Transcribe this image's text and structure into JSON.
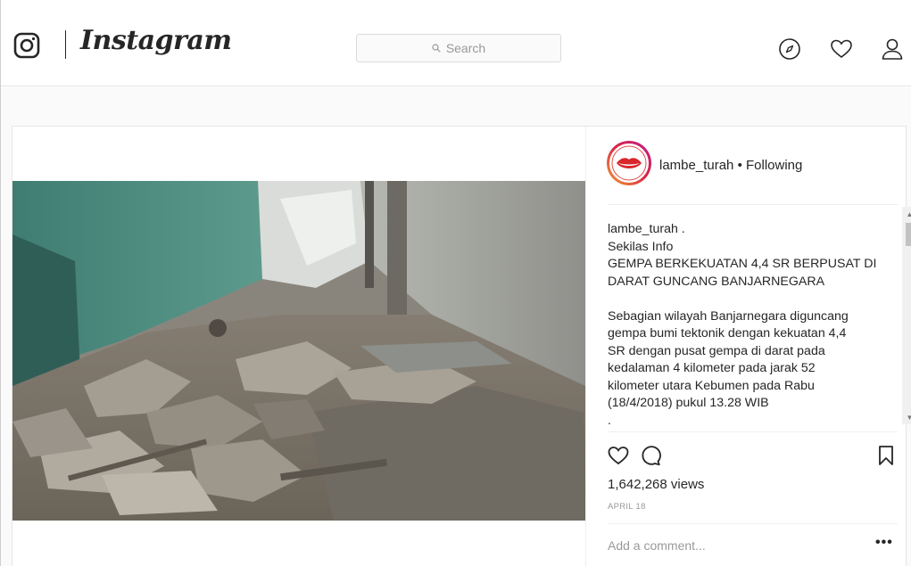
{
  "nav": {
    "brand": "Instagram",
    "search_placeholder": "Search",
    "icons": [
      "instagram-logo-icon",
      "compass-icon",
      "heart-icon",
      "person-icon"
    ]
  },
  "post": {
    "username": "lambe_turah",
    "separator": "•",
    "follow_status": "Following",
    "caption_lines": [
      "lambe_turah .",
      "Sekilas Info",
      "GEMPA BERKEKUATAN 4,4 SR BERPUSAT DI",
      "DARAT GUNCANG BANJARNEGARA",
      "",
      "Sebagian wilayah Banjarnegara diguncang",
      "gempa bumi tektonik dengan kekuatan 4,4",
      "SR dengan pusat gempa di darat pada",
      "kedalaman 4 kilometer pada jarak 52",
      "kilometer utara Kebumen pada Rabu",
      "(18/4/2018) pukul 13.28 WIB",
      "."
    ],
    "views": "1,642,268 views",
    "date": "APRIL 18",
    "comment_placeholder": "Add a comment...",
    "more_label": "•••"
  },
  "colors": {
    "text": "#262626",
    "muted": "#999999",
    "border": "#efefef",
    "avatar_ring": "#dc2743"
  }
}
